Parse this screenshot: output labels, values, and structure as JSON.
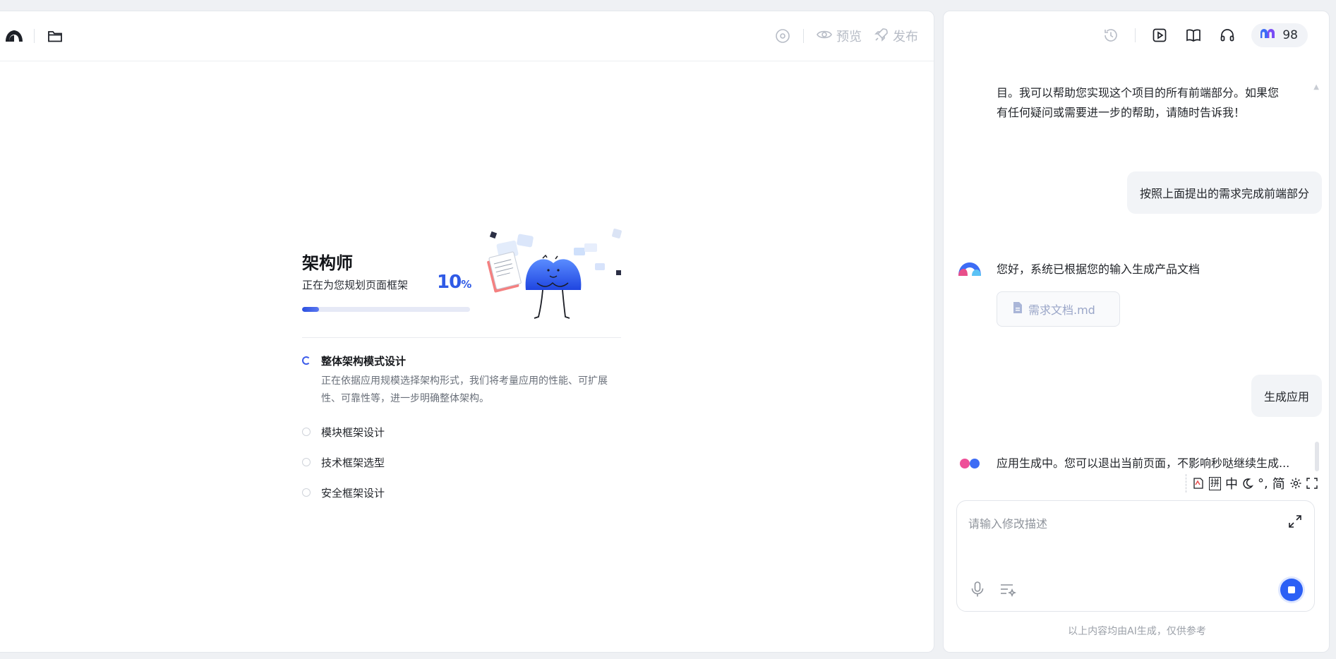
{
  "left": {
    "header": {
      "preview_label": "预览",
      "publish_label": "发布"
    },
    "architect": {
      "title": "架构师",
      "subtitle": "正在为您规划页面框架",
      "progress_number": "10",
      "progress_unit": "%",
      "progress_fraction": 0.1,
      "steps": [
        {
          "label": "整体架构模式设计",
          "desc": "正在依据应用规模选择架构形式，我们将考量应用的性能、可扩展性、可靠性等，进一步明确整体架构。",
          "state": "active"
        },
        {
          "label": "模块框架设计",
          "state": "pending"
        },
        {
          "label": "技术框架选型",
          "state": "pending"
        },
        {
          "label": "安全框架设计",
          "state": "pending"
        }
      ]
    }
  },
  "right": {
    "header": {
      "credits": "98"
    },
    "messages": {
      "ai_1_line1": "目。我可以帮助您实现这个项目的所有前端部分。如果您",
      "ai_1_line2": "有任何疑问或需要进一步的帮助，请随时告诉我！",
      "user_1": "按照上面提出的需求完成前端部分",
      "ai_2": "您好，系统已根据您的输入生成产品文档",
      "file_name": "需求文档.md",
      "user_2": "生成应用",
      "ai_3": "应用生成中。您可以退出当前页面，不影响秒哒继续生成..."
    },
    "ime": {
      "pinyin": "拼",
      "mode": "中",
      "punct": "°,",
      "simplified": "简"
    },
    "composer": {
      "placeholder": "请输入修改描述"
    },
    "disclaimer": "以上内容均由AI生成，仅供参考"
  },
  "colors": {
    "accent": "#2b5ff5",
    "progress": "#2f5ae6",
    "muted": "#b7bcc6"
  }
}
